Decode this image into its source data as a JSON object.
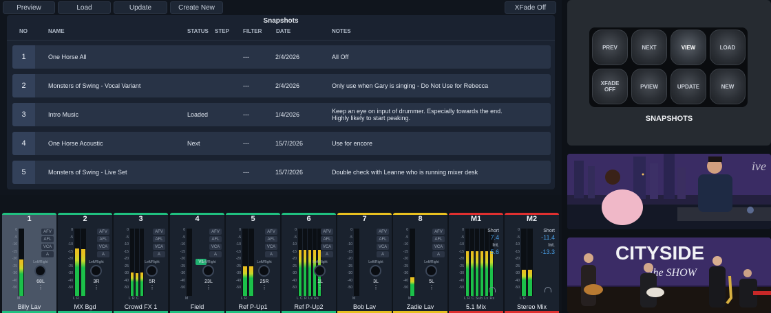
{
  "toolbar": {
    "preview": "Preview",
    "load": "Load",
    "update": "Update",
    "create_new": "Create New",
    "xfade": "XFade Off"
  },
  "snapshots": {
    "title": "Snapshots",
    "columns": {
      "no": "NO",
      "name": "NAME",
      "status": "STATUS",
      "step": "STEP",
      "filter": "FILTER",
      "date": "DATE",
      "notes": "NOTES"
    },
    "rows": [
      {
        "no": "1",
        "name": "One Horse All",
        "status": "",
        "filter": "---",
        "date": "2/4/2026",
        "notes": "All Off"
      },
      {
        "no": "2",
        "name": "Monsters of Swing - Vocal Variant",
        "status": "",
        "filter": "---",
        "date": "2/4/2026",
        "notes": "Only use when Gary is singing - Do Not Use for Rebecca"
      },
      {
        "no": "3",
        "name": "Intro Music",
        "status": "Loaded",
        "filter": "---",
        "date": "1/4/2026",
        "notes": "Keep an eye on input of drummer. Especially towards the end. Highly likely to start peaking."
      },
      {
        "no": "4",
        "name": "One Horse Acoustic",
        "status": "Next",
        "filter": "---",
        "date": "15/7/2026",
        "notes": "Use for encore"
      },
      {
        "no": "5",
        "name": "Monsters of Swing - Live Set",
        "status": "",
        "filter": "---",
        "date": "15/7/2026",
        "notes": "Double check with Leanne who is running mixer desk"
      }
    ]
  },
  "mixer": {
    "scale": [
      "0",
      "-5",
      "-10",
      "-15",
      "-20",
      "-25",
      "-30",
      "-40",
      "-50"
    ],
    "tags": [
      "AFV",
      "AFL",
      "VCA",
      "A"
    ],
    "pan_label": "Left/Right",
    "channels": [
      {
        "num": "1",
        "label": "Billy Lav",
        "pan": "68L",
        "color": "#20c080",
        "level": 0.55,
        "selected": true,
        "sub": "M"
      },
      {
        "num": "2",
        "label": "MX Bgd",
        "pan": "3R",
        "color": "#20c080",
        "level": 0.72,
        "selected": false,
        "sub": "L R"
      },
      {
        "num": "3",
        "label": "Crowd FX 1",
        "pan": "5R",
        "color": "#20c080",
        "level": 0.35,
        "selected": false,
        "sub": "L R C"
      },
      {
        "num": "4",
        "label": "Field",
        "pan": "23L",
        "color": "#20c080",
        "level": 0.0,
        "selected": false,
        "sub": "M",
        "v1": "V1"
      },
      {
        "num": "5",
        "label": "Ref P-Up1",
        "pan": "25R",
        "color": "#20c080",
        "level": 0.45,
        "selected": false,
        "sub": "L R"
      },
      {
        "num": "6",
        "label": "Ref P-Up2",
        "pan": "1L",
        "color": "#20c080",
        "level": 0.7,
        "selected": false,
        "sub": "L C R Ls Rs"
      },
      {
        "num": "7",
        "label": "Bob Lav",
        "pan": "3L",
        "color": "#e8c020",
        "level": 0.0,
        "selected": false,
        "sub": "M"
      },
      {
        "num": "8",
        "label": "Zadie Lav",
        "pan": "5L",
        "color": "#e8c020",
        "level": 0.28,
        "selected": false,
        "sub": "M"
      },
      {
        "num": "M1",
        "label": "5.1 Mix",
        "color": "#e03030",
        "level": 0.68,
        "selected": false,
        "short_label": "Short",
        "short_value": "7.4",
        "int_label": "Int.",
        "int_value": "5.6",
        "sub": "L R C Sub Ls Rs"
      },
      {
        "num": "M2",
        "label": "Stereo Mix",
        "color": "#e03030",
        "level": 0.4,
        "selected": false,
        "short_label": "Short",
        "short_value": "-11.4",
        "int_label": "Int.",
        "int_value": "-13.3",
        "sub": "L R"
      }
    ]
  },
  "deck": {
    "buttons": [
      "PREV",
      "NEXT",
      "VIEW",
      "LOAD",
      "XFADE OFF",
      "PVIEW",
      "UPDATE",
      "NEW"
    ],
    "label": "SNAPSHOTS"
  },
  "camera2": {
    "sign": "CITYSIDE",
    "sign2": "the SHOW"
  }
}
